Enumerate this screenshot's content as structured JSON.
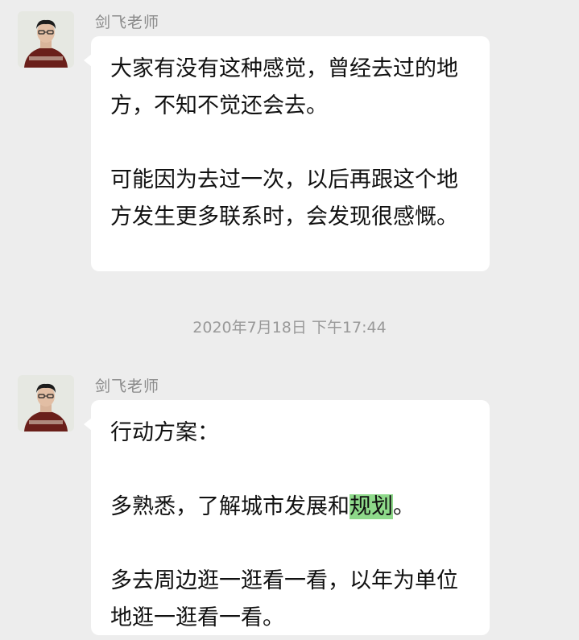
{
  "messages": [
    {
      "sender": "剑飞老师",
      "paragraphs": [
        "大家有没有这种感觉，曾经去过的地方，不知不觉还会去。",
        "可能因为去过一次，以后再跟这个地方发生更多联系时，会发现很感慨。"
      ]
    },
    {
      "sender": "剑飞老师",
      "para1": "行动方案：",
      "para2_before": "多熟悉，了解城市发展和",
      "para2_highlight": "规划",
      "para2_after": "。",
      "para3": "多去周边逛一逛看一看，以年为单位地逛一逛看一看。"
    }
  ],
  "timestamp": "2020年7月18日 下午17:44",
  "colors": {
    "background": "#ededed",
    "bubble": "#ffffff",
    "highlight": "#8ed98a"
  }
}
